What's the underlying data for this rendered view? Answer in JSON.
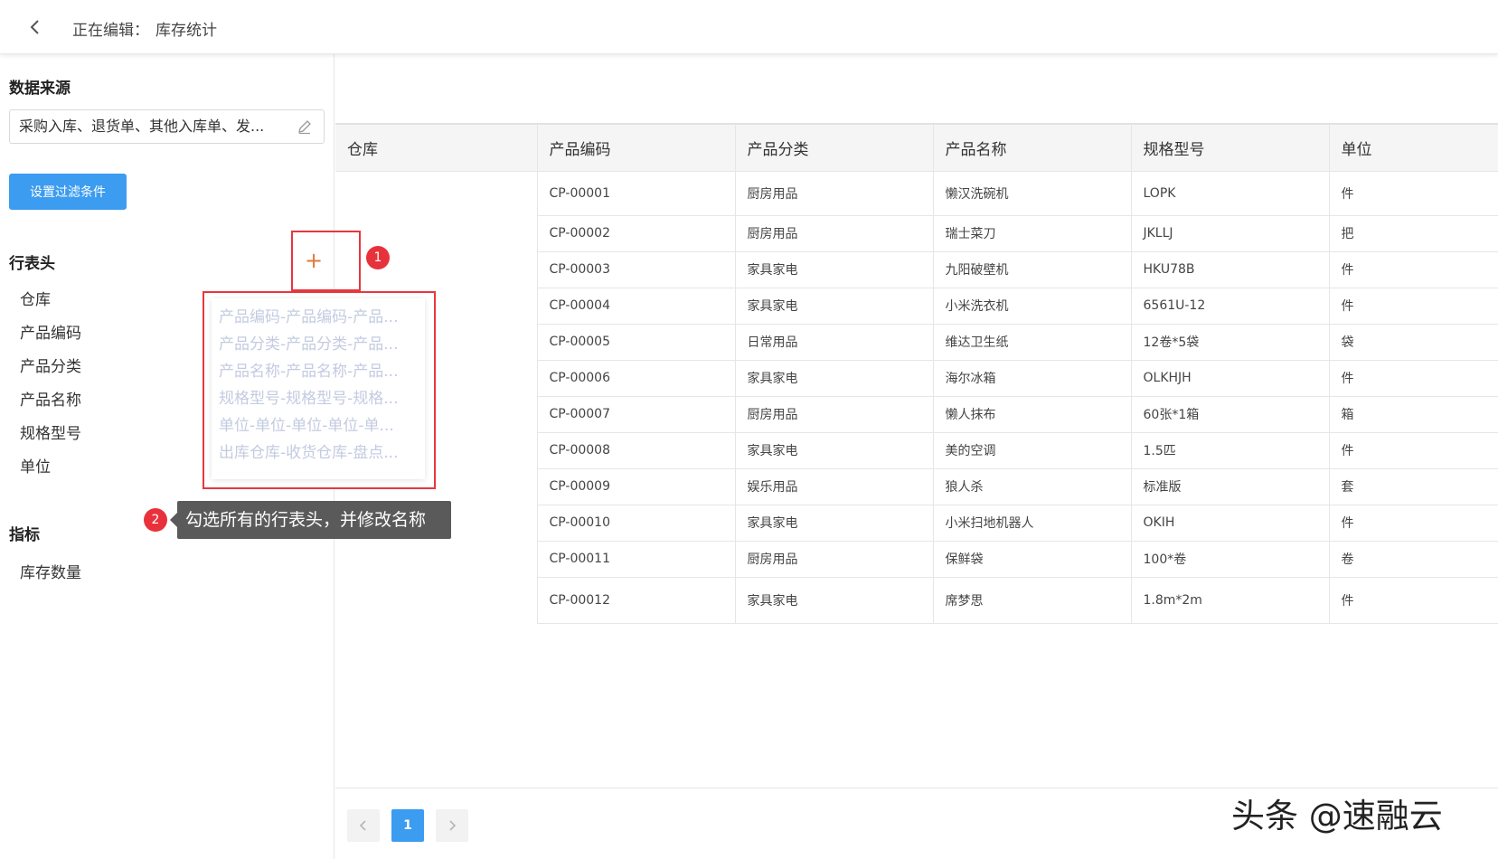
{
  "header": {
    "editing_label": "正在编辑：",
    "report_name": "库存统计"
  },
  "sidebar": {
    "data_source_title": "数据来源",
    "data_source_value": "采购入库、退货单、其他入库单、发...",
    "filter_button": "设置过滤条件",
    "row_header_title": "行表头",
    "row_headers": [
      "仓库",
      "产品编码",
      "产品分类",
      "产品名称",
      "规格型号",
      "单位"
    ],
    "metric_title": "指标",
    "metrics": [
      "库存数量"
    ]
  },
  "annotations": {
    "badge1": "1",
    "badge2": "2",
    "tooltip": "勾选所有的行表头，并修改名称",
    "dropdown_options": [
      "产品编码-产品编码-产品...",
      "产品分类-产品分类-产品...",
      "产品名称-产品名称-产品...",
      "规格型号-规格型号-规格...",
      "单位-单位-单位-单位-单...",
      "出库仓库-收货仓库-盘点..."
    ]
  },
  "table": {
    "columns": [
      "仓库",
      "产品编码",
      "产品分类",
      "产品名称",
      "规格型号",
      "单位"
    ],
    "rows": [
      [
        "CP-00001",
        "厨房用品",
        "懒汉洗碗机",
        "LOPK",
        "件"
      ],
      [
        "CP-00002",
        "厨房用品",
        "瑞士菜刀",
        "JKLLJ",
        "把"
      ],
      [
        "CP-00003",
        "家具家电",
        "九阳破壁机",
        "HKU78B",
        "件"
      ],
      [
        "CP-00004",
        "家具家电",
        "小米洗衣机",
        "6561U-12",
        "件"
      ],
      [
        "CP-00005",
        "日常用品",
        "维达卫生纸",
        "12卷*5袋",
        "袋"
      ],
      [
        "CP-00006",
        "家具家电",
        "海尔冰箱",
        "OLKHJH",
        "件"
      ],
      [
        "CP-00007",
        "厨房用品",
        "懒人抹布",
        "60张*1箱",
        "箱"
      ],
      [
        "CP-00008",
        "家具家电",
        "美的空调",
        "1.5匹",
        "件"
      ],
      [
        "CP-00009",
        "娱乐用品",
        "狼人杀",
        "标准版",
        "套"
      ],
      [
        "CP-00010",
        "家具家电",
        "小米扫地机器人",
        "OKIH",
        "件"
      ],
      [
        "CP-00011",
        "厨房用品",
        "保鲜袋",
        "100*卷",
        "卷"
      ],
      [
        "CP-00012",
        "家具家电",
        "席梦思",
        "1.8m*2m",
        "件"
      ]
    ]
  },
  "pagination": {
    "current_page": "1",
    "prev_icon": "chevron-left-icon",
    "next_icon": "chevron-right-icon"
  },
  "watermark": "头条 @速融云",
  "colors": {
    "primary": "#3b9cf0",
    "annotation_red": "#e6373e"
  }
}
